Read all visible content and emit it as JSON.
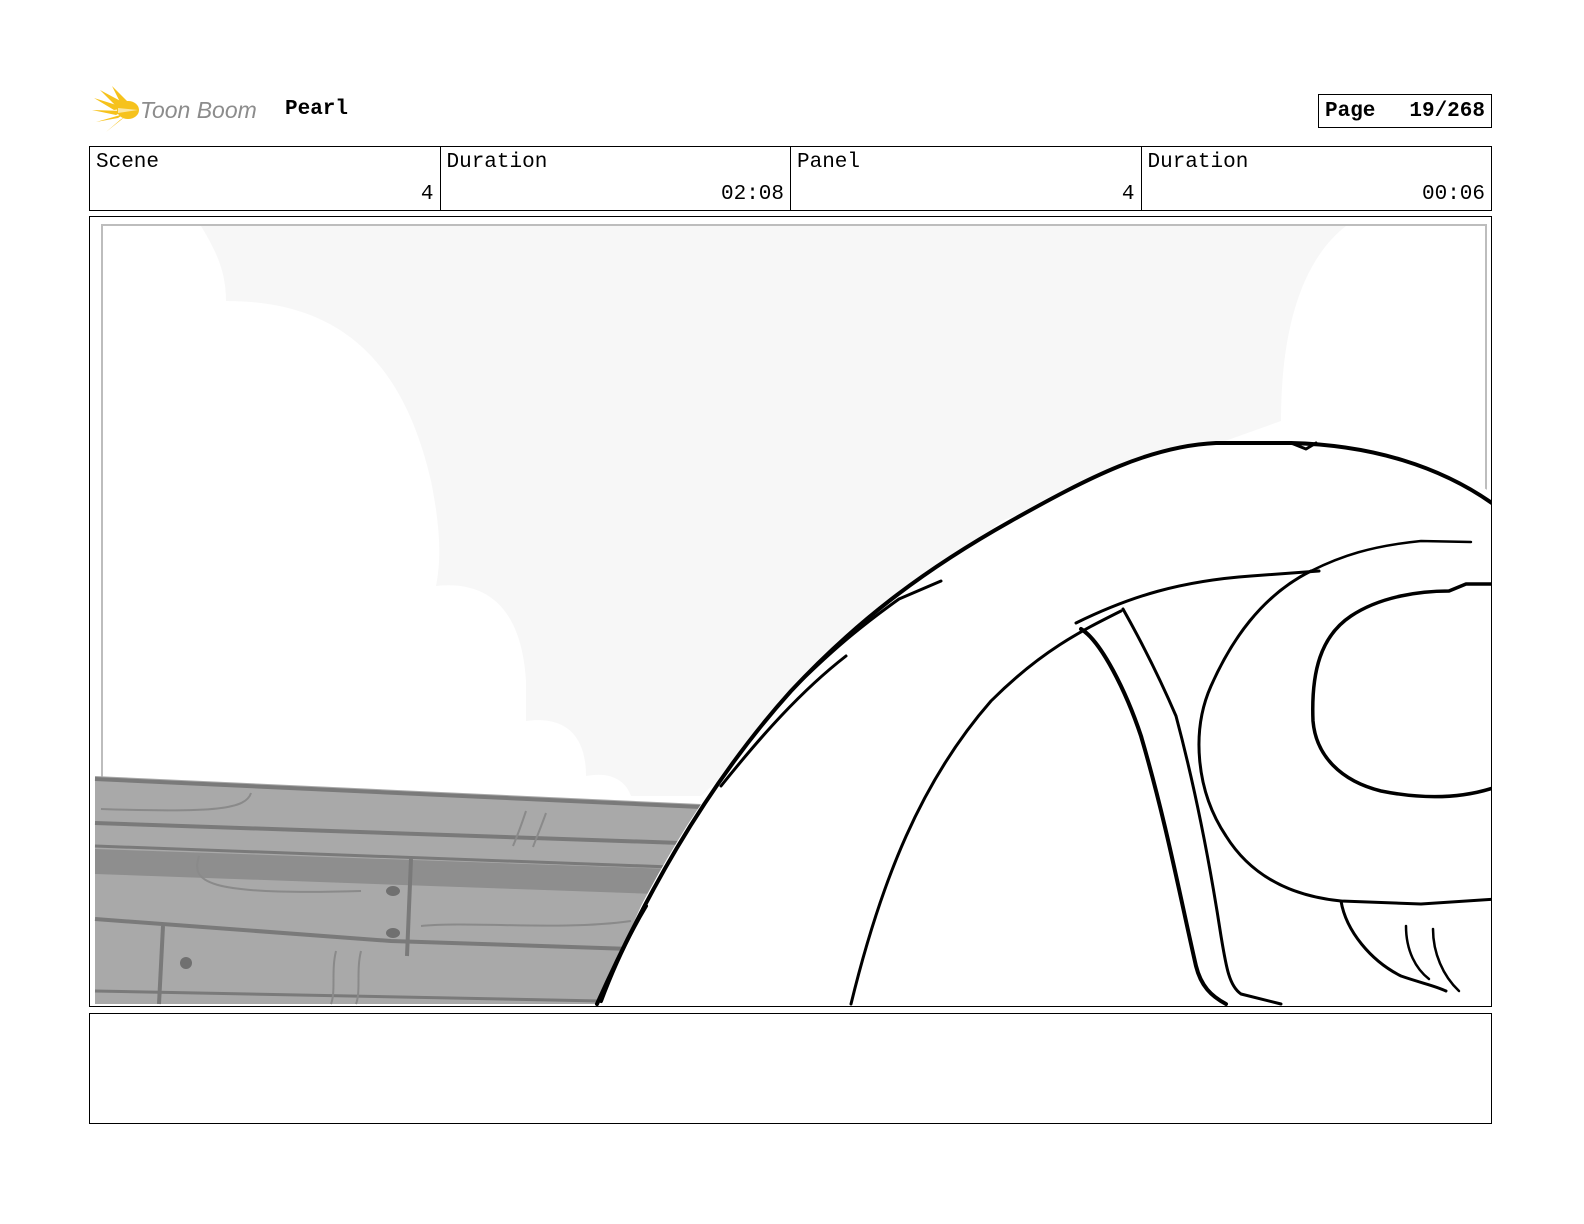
{
  "header": {
    "logo_text": "Toon Boom",
    "project_title": "Pearl",
    "page_label": "Page",
    "page_number": "19/268"
  },
  "info": {
    "scene_label": "Scene",
    "scene_value": "4",
    "scene_duration_label": "Duration",
    "scene_duration_value": "02:08",
    "panel_label": "Panel",
    "panel_value": "4",
    "panel_duration_label": "Duration",
    "panel_duration_value": "00:06"
  },
  "notes": {
    "text": ""
  },
  "colors": {
    "logo_yellow": "#f6c21c",
    "logo_gray": "#8c8c8c",
    "sky": "#f7f7f7",
    "wood_light": "#a9a9a9",
    "wood_dark": "#8e8e8e"
  }
}
